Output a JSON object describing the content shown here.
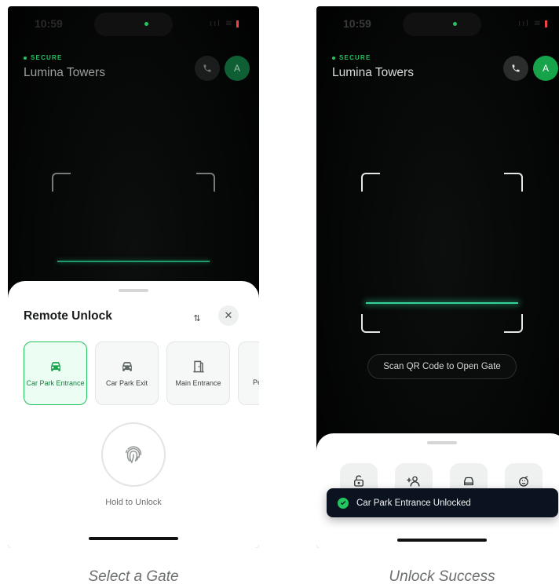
{
  "status": {
    "time": "10:59",
    "signal": "ııl",
    "wifi": "≋"
  },
  "header": {
    "secure_label": "SECURE",
    "building": "Lumina Towers",
    "avatar_initial": "A"
  },
  "left_screen": {
    "sheet_title": "Remote Unlock",
    "sort_glyph": "⇅",
    "close_glyph": "✕",
    "gates": [
      {
        "label": "Car Park Entrance",
        "selected": true
      },
      {
        "label": "Car Park Exit",
        "selected": false
      },
      {
        "label": "Main Entrance",
        "selected": false
      },
      {
        "label": "Pe",
        "selected": false
      }
    ],
    "hold_label": "Hold to Unlock"
  },
  "right_screen": {
    "scan_prompt": "Scan QR Code to Open Gate",
    "toast": "Car Park Entrance Unlocked"
  },
  "captions": {
    "left": "Select a Gate",
    "right": "Unlock Success"
  },
  "colors": {
    "accent": "#22c55e",
    "toast_bg": "#0b1220",
    "sheet_bg": "#ffffff"
  }
}
